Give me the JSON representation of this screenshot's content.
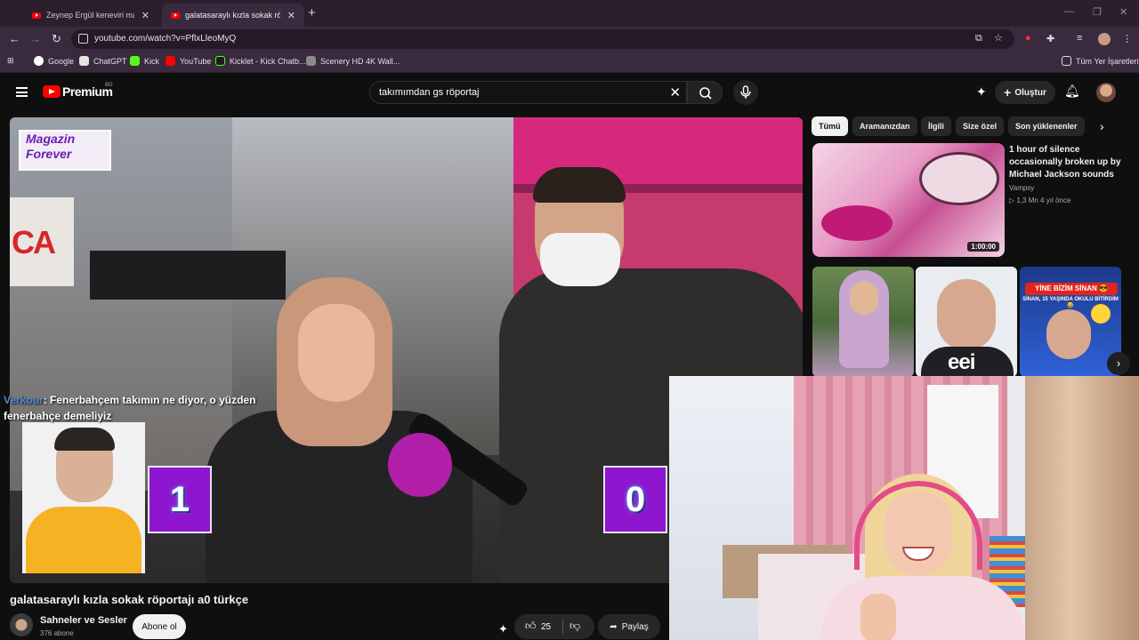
{
  "browser": {
    "tabs": [
      {
        "label": "Zeynep Ergül keneviri marul sa",
        "active": false
      },
      {
        "label": "galatasaraylı kızla sokak röp",
        "active": true
      }
    ],
    "new_tab": "+",
    "url": "youtube.com/watch?v=PflxLleoMyQ",
    "bookmarks": [
      "Google",
      "ChatGPT",
      "Kick",
      "YouTube",
      "Kicklet - Kick Chatb...",
      "Scenery HD 4K Wall..."
    ],
    "all_bookmarks": "Tüm Yer İşaretleri"
  },
  "youtube": {
    "logo_text": "Premium",
    "region": "BG",
    "search_value": "takımımdan gs röportaj",
    "create_label": "Oluştur"
  },
  "video": {
    "overlay_logo_line1": "Magazin",
    "overlay_logo_line2": "Forever",
    "chat_user": "Verkour",
    "chat_message": ": Fenerbahçem takımın ne diyor, o yüzden fenerbahçe demeliyiz",
    "score_left": "1",
    "score_right": "0",
    "title": "galatasaraylı kızla sokak röportajı a0 türkçe",
    "channel": "Sahneler ve Sesler",
    "subscribers": "376 abone",
    "subscribe_label": "Abone ol",
    "likes": "25",
    "share_label": "Paylaş"
  },
  "chips": [
    "Tümü",
    "Aramanızdan",
    "İlgili",
    "Size özel",
    "Son yüklenenler"
  ],
  "recommendation": {
    "title": "1 hour of silence occasionally broken up by Michael Jackson sounds",
    "channel": "Vampsy",
    "meta": "▷ 1,3 Mn   4 yıl önce",
    "duration": "1:00:00"
  },
  "shorts": {
    "short2_text": "eei",
    "short3_banner": "YİNE BİZİM SİNAN 😎",
    "short3_sub": "SİNAN, 15 YAŞINDA OKULU BİTİRDİM 😂"
  },
  "colors": {
    "accent_red": "#ff0000",
    "background": "#0f0f0f",
    "score_purple": "#8e16cf"
  }
}
